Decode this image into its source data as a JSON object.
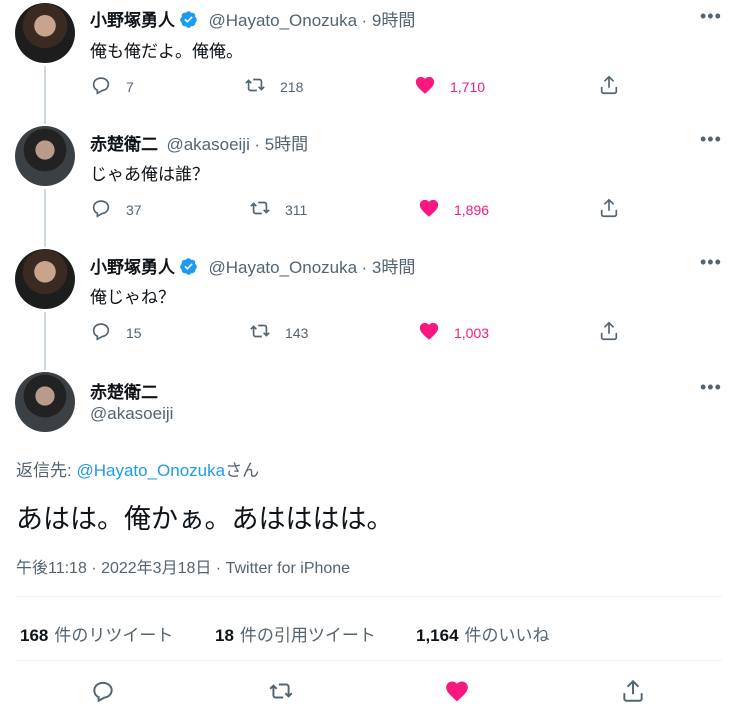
{
  "tweets": [
    {
      "name": "小野塚勇人",
      "handle": "@Hayato_Onozuka",
      "time": "· 9時間",
      "text": "俺も俺だよ。俺俺。",
      "replies": "7",
      "retweets": "218",
      "likes": "1,710"
    },
    {
      "name": "赤楚衛二",
      "handle": "@akasoeiji",
      "time": "· 5時間",
      "text": "じゃあ俺は誰？",
      "replies": "37",
      "retweets": "311",
      "likes": "1,896"
    },
    {
      "name": "小野塚勇人",
      "handle": "@Hayato_Onozuka",
      "time": "· 3時間",
      "text": "俺じゃね？",
      "replies": "15",
      "retweets": "143",
      "likes": "1,003"
    }
  ],
  "main": {
    "name": "赤楚衛二",
    "handle": "@akasoeiji",
    "reply_prefix": "返信先: ",
    "reply_to": "@Hayato_Onozuka",
    "reply_suffix": "さん",
    "text": "あはは。俺かぁ。あはははは。",
    "timestamp": "午後11:18 · 2022年3月18日 · Twitter for iPhone",
    "stats": [
      {
        "num": "168",
        "label": "件のリツイート"
      },
      {
        "num": "18",
        "label": "件の引用ツイート"
      },
      {
        "num": "1,164",
        "label": "件のいいね"
      }
    ]
  },
  "more_glyph": "•••",
  "colors": {
    "accent": "#1d9bf0",
    "like": "#f91880",
    "muted": "#536471",
    "text": "#0f1419"
  },
  "icons": [
    "verified-badge-icon",
    "reply-icon",
    "retweet-icon",
    "heart-icon",
    "share-icon",
    "more-icon"
  ]
}
